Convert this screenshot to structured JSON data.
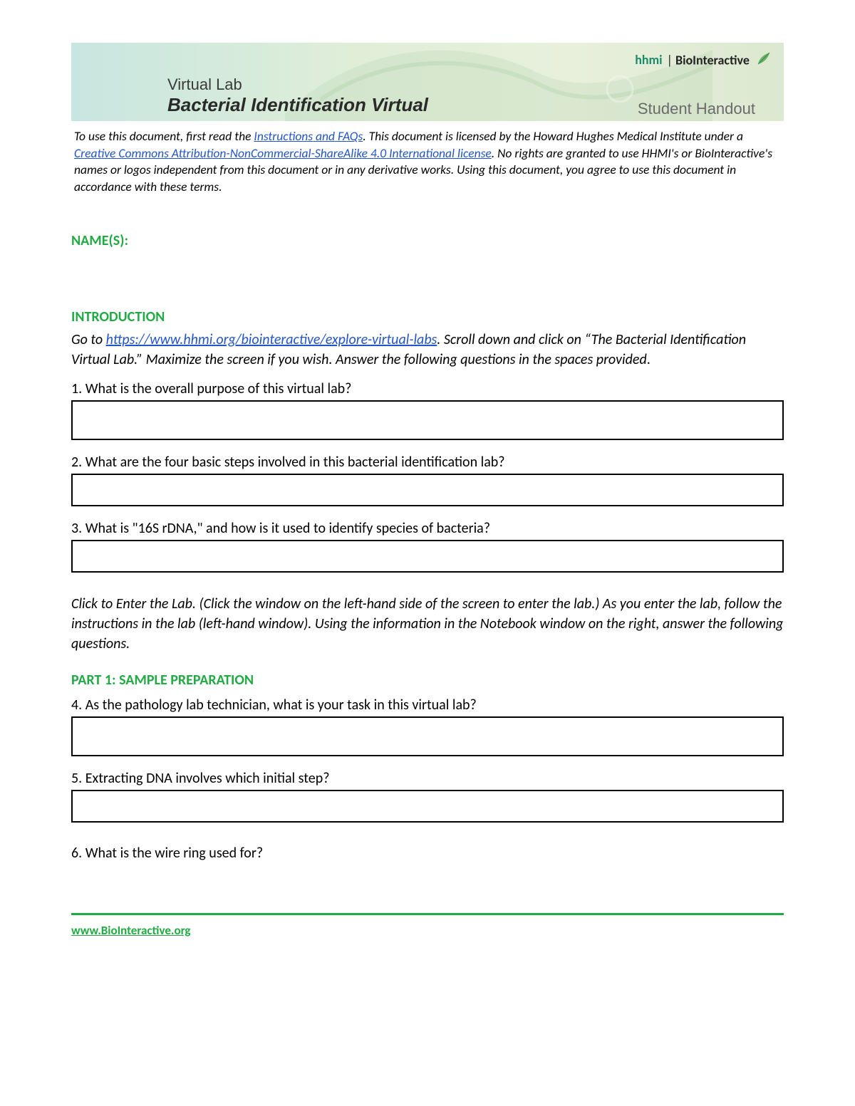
{
  "banner": {
    "subtitle": "Virtual Lab",
    "title": "Bacterial Identification Virtual",
    "logo_hhmi": "hhmi",
    "logo_sep": "|",
    "logo_bio": "BioInteractive",
    "handout_label": "Student Handout"
  },
  "license": {
    "prefix": "To use this document, first read the ",
    "instructions_link": "Instructions and FAQs",
    "mid1": ". This document is licensed by the Howard Hughes Medical Institute under a",
    "cc_link": " Creative Commons Attribution-NonCommercial-ShareAlike 4.0 International license",
    "suffix": ". No rights are granted to use HHMI's or BioInteractive's names or logos independent from this document or in any derivative works. Using this document, you agree to use this document in accordance with these terms."
  },
  "headings": {
    "names": "NAME(S):",
    "introduction": "INTRODUCTION",
    "part1": "PART 1: SAMPLE PREPARATION"
  },
  "intro": {
    "go_to": "Go to ",
    "url": "https://www.hhmi.org/biointeractive/explore-virtual-labs",
    "rest": ". Scroll down and click on “The Bacterial Identification Virtual Lab.” Maximize the screen if you wish. Answer the following questions in the spaces provided",
    "period": "."
  },
  "questions": {
    "q1": "1. What is the overall purpose of this virtual lab?",
    "q2": "2. What are the four basic steps involved in this bacterial identification lab?",
    "q3": "3. What is \"16S rDNA,\" and how is it used to identify species of bacteria?",
    "q4": "4. As the pathology lab technician, what is your task in this virtual lab?",
    "q5": "5. Extracting DNA involves which initial step?",
    "q6": "6. What is the wire ring used for?"
  },
  "part1_instructions": "Click to Enter the Lab. (Click the window on the left-hand side of the screen to enter the lab.) As you enter the lab, follow the instructions in the lab (left-hand window). Using the information in the Notebook window on the right, answer the following questions.",
  "footer": {
    "link": "www.BioInteractive.org"
  }
}
